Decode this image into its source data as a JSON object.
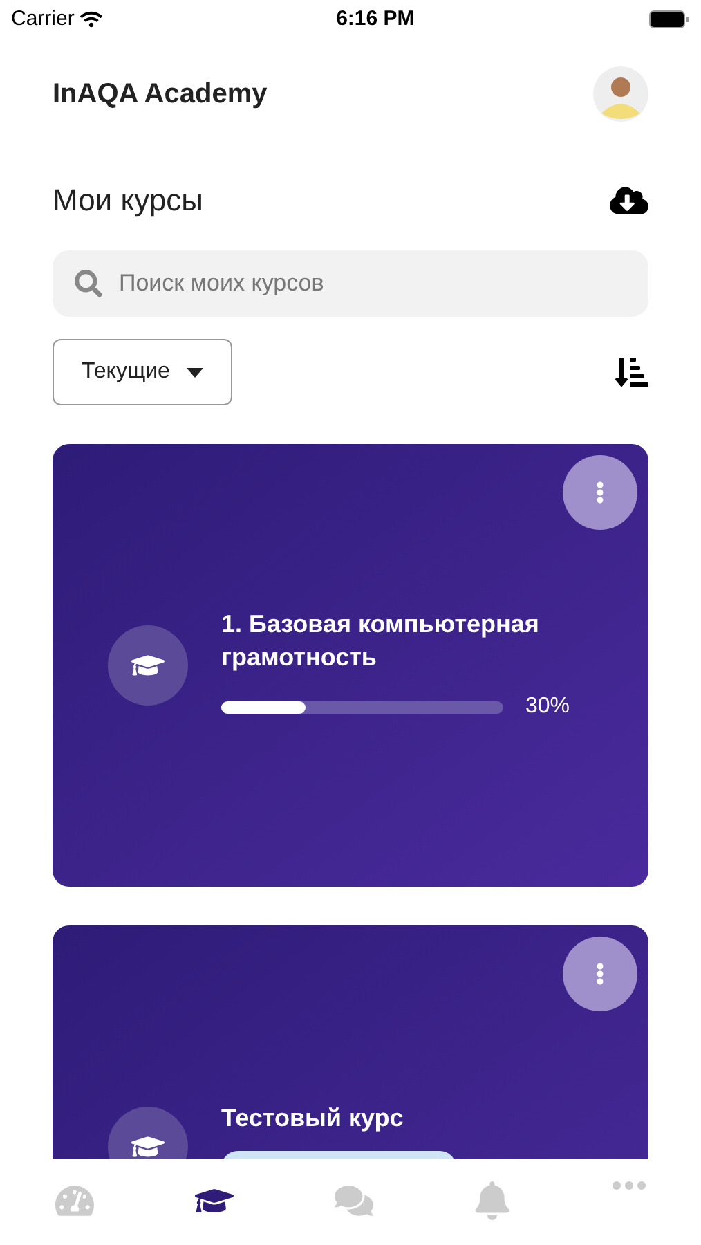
{
  "status_bar": {
    "carrier": "Carrier",
    "time": "6:16 PM"
  },
  "header": {
    "title": "InAQA Academy"
  },
  "section": {
    "title": "Мои курсы"
  },
  "search": {
    "placeholder": "Поиск моих курсов"
  },
  "filter": {
    "value": "Текущие"
  },
  "courses": [
    {
      "title": "1. Базовая компьютерная грамотность",
      "level": 0.3,
      "reading": "30%",
      "badge": false
    },
    {
      "title": "Тестовый курс",
      "badge": true
    }
  ],
  "tabs": [
    {
      "kind": "dashboard",
      "selected": false
    },
    {
      "kind": "courses",
      "selected": true
    },
    {
      "kind": "chat",
      "selected": false
    },
    {
      "kind": "bell",
      "selected": false
    },
    {
      "kind": "more",
      "selected": false
    }
  ]
}
